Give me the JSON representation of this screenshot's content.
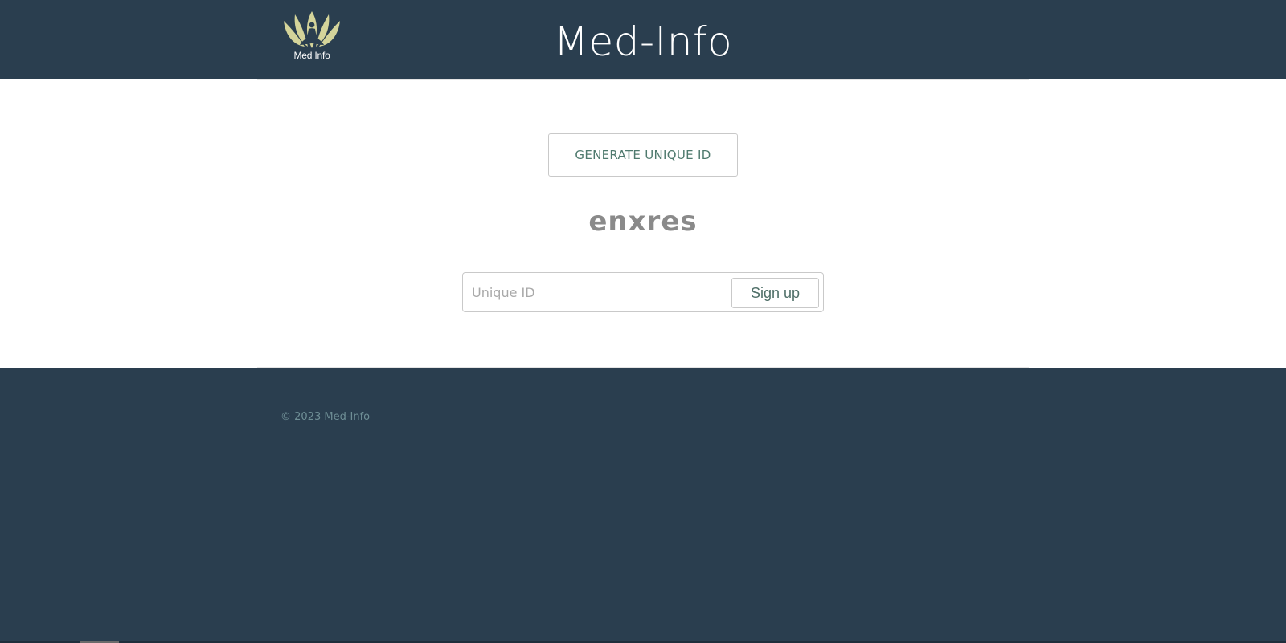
{
  "header": {
    "logo_text": "Med Info",
    "title": "Med-Info"
  },
  "main": {
    "generate_button_label": "GENERATE UNIQUE ID",
    "generated_id": "enxres",
    "input_placeholder": "Unique ID",
    "input_value": "",
    "signup_button_label": "Sign up"
  },
  "footer": {
    "copyright": "© 2023 Med-Info"
  },
  "colors": {
    "background": "#2a3e4f",
    "accent": "#4f7a6e",
    "logo": "#d4d49a"
  },
  "icons": {
    "logo": "lotus-meditation-icon"
  }
}
